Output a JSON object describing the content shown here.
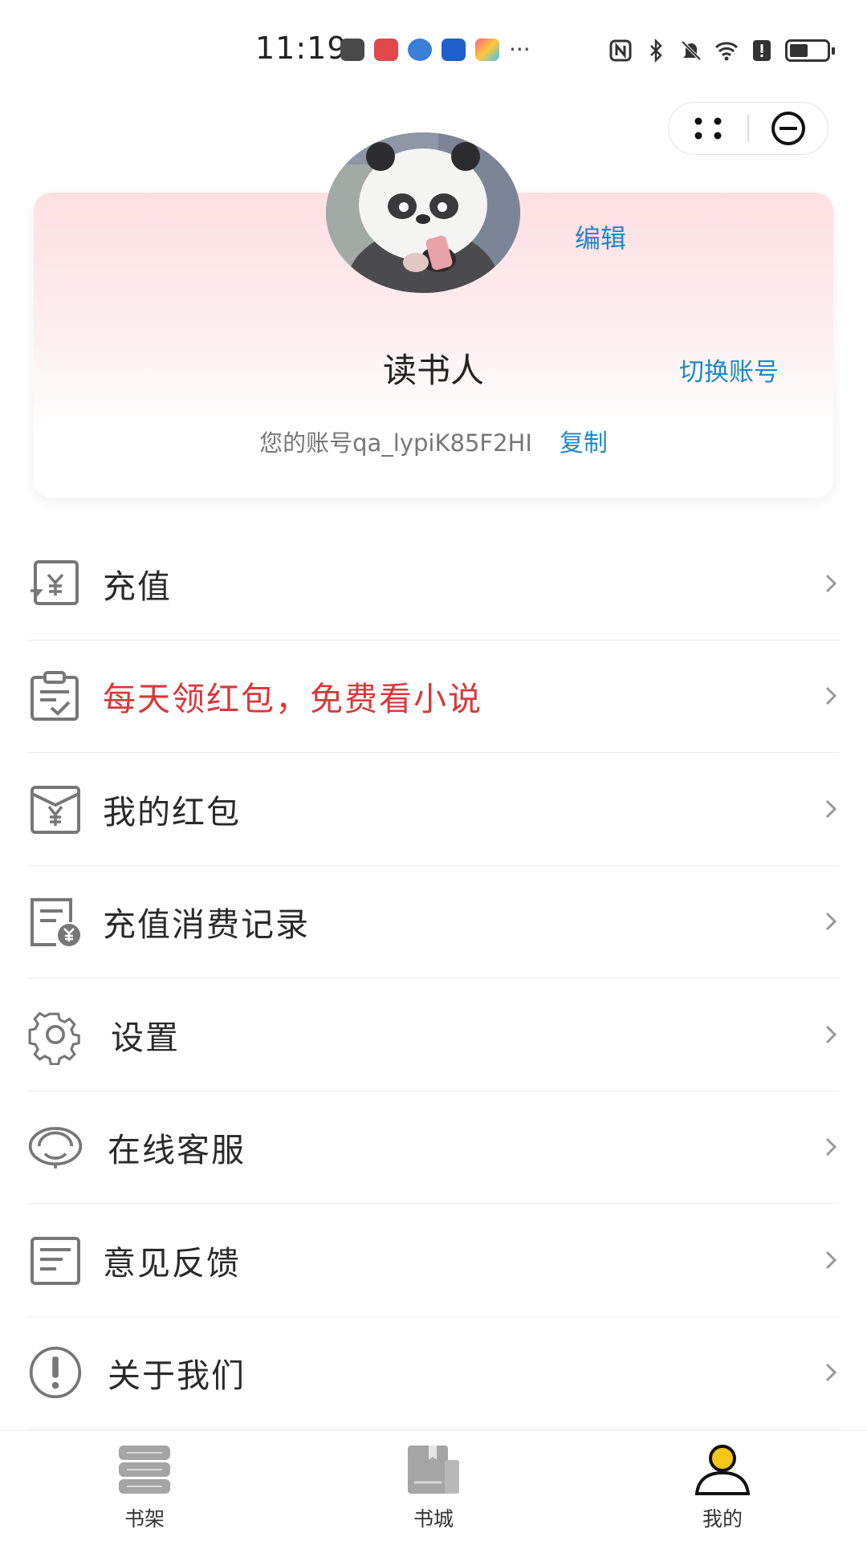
{
  "status_bar": {
    "time": "11:19",
    "notification_icons": [
      "huawei-icon",
      "red-app-icon",
      "blue-app-icon",
      "bulb-app-icon",
      "colorful-app-icon"
    ],
    "more": "···",
    "system_icons": [
      "nfc-icon",
      "bluetooth-icon",
      "mute-icon",
      "wifi-icon",
      "alert-icon",
      "battery-icon"
    ]
  },
  "capsule": {
    "more_icon": "dots-icon",
    "close_icon": "minus-circle-icon"
  },
  "profile": {
    "edit_label": "编辑",
    "name": "读书人",
    "switch_label": "切换账号",
    "account_text": "您的账号qa_lypiK85F2HI",
    "copy_label": "复制"
  },
  "menu": [
    {
      "label": "充值",
      "icon": "recharge-icon",
      "highlight": false
    },
    {
      "label": "每天领红包，免费看小说",
      "icon": "checklist-icon",
      "highlight": true
    },
    {
      "label": "我的红包",
      "icon": "red-envelope-icon",
      "highlight": false
    },
    {
      "label": "充值消费记录",
      "icon": "record-icon",
      "highlight": false
    },
    {
      "label": "设置",
      "icon": "gear-icon",
      "highlight": false
    },
    {
      "label": "在线客服",
      "icon": "headset-icon",
      "highlight": false
    },
    {
      "label": "意见反馈",
      "icon": "feedback-icon",
      "highlight": false
    },
    {
      "label": "关于我们",
      "icon": "info-icon",
      "highlight": false
    }
  ],
  "tabs": [
    {
      "label": "书架",
      "icon": "bookshelf-icon",
      "active": false
    },
    {
      "label": "书城",
      "icon": "bookstore-icon",
      "active": false
    },
    {
      "label": "我的",
      "icon": "user-icon",
      "active": true
    }
  ],
  "colors": {
    "link": "#1e88c8",
    "highlight": "#d9383a",
    "active_tab": "#f5c518"
  }
}
